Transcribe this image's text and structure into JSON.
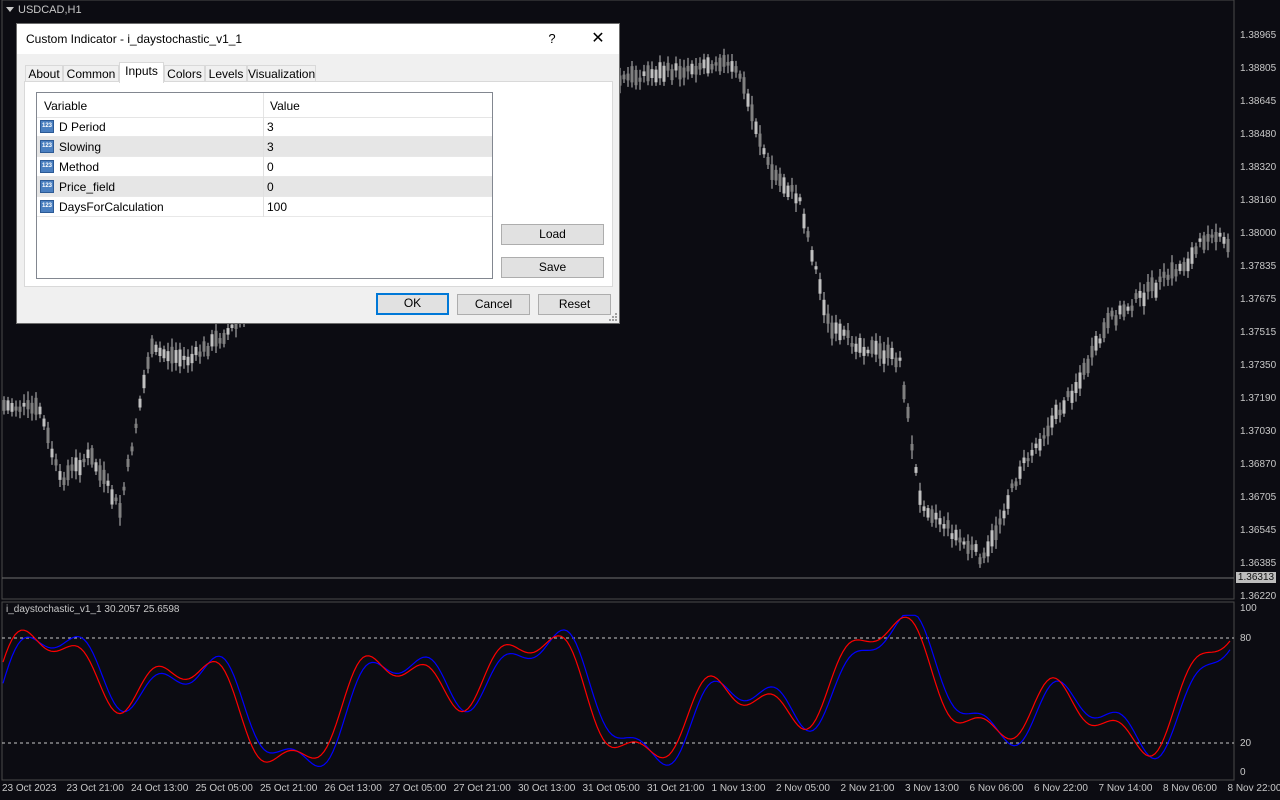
{
  "chart": {
    "symbol": "USDCAD,H1",
    "current_price": "1.36313",
    "price_axis": [
      "1.38965",
      "1.38805",
      "1.38645",
      "1.38480",
      "1.38320",
      "1.38160",
      "1.38000",
      "1.37835",
      "1.37675",
      "1.37515",
      "1.37350",
      "1.37190",
      "1.37030",
      "1.36870",
      "1.36705",
      "1.36545",
      "1.36385",
      "1.36220"
    ],
    "dates": [
      "23 Oct 2023",
      "23 Oct 21:00",
      "24 Oct 13:00",
      "25 Oct 05:00",
      "25 Oct 21:00",
      "26 Oct 13:00",
      "27 Oct 05:00",
      "27 Oct 21:00",
      "30 Oct 13:00",
      "31 Oct 05:00",
      "31 Oct 21:00",
      "1 Nov 13:00",
      "2 Nov 05:00",
      "2 Nov 21:00",
      "3 Nov 13:00",
      "6 Nov 06:00",
      "6 Nov 22:00",
      "7 Nov 14:00",
      "8 Nov 06:00",
      "8 Nov 22:00"
    ],
    "colors": {
      "background": "#0c0c12",
      "candle": "#c0c0c0",
      "main_line": "#0000ff",
      "signal_line": "#ff0000"
    }
  },
  "indicator": {
    "label": "i_daystochastic_v1_1 30.2057 25.6598",
    "axis": [
      "100",
      "80",
      "20",
      "0"
    ]
  },
  "dialog": {
    "title": "Custom Indicator - i_daystochastic_v1_1",
    "help": "?",
    "close": "✕",
    "tabs": [
      "About",
      "Common",
      "Inputs",
      "Colors",
      "Levels",
      "Visualization"
    ],
    "active_tab": "Inputs",
    "columns": {
      "variable": "Variable",
      "value": "Value"
    },
    "inputs": [
      {
        "icon": "123",
        "variable": "D Period",
        "value": "3"
      },
      {
        "icon": "123",
        "variable": "Slowing",
        "value": "3"
      },
      {
        "icon": "123",
        "variable": "Method",
        "value": "0"
      },
      {
        "icon": "123",
        "variable": "Price_field",
        "value": "0"
      },
      {
        "icon": "123",
        "variable": "DaysForCalculation",
        "value": "100"
      }
    ],
    "load_label": "Load",
    "save_label": "Save",
    "ok_label": "OK",
    "cancel_label": "Cancel",
    "reset_label": "Reset"
  }
}
